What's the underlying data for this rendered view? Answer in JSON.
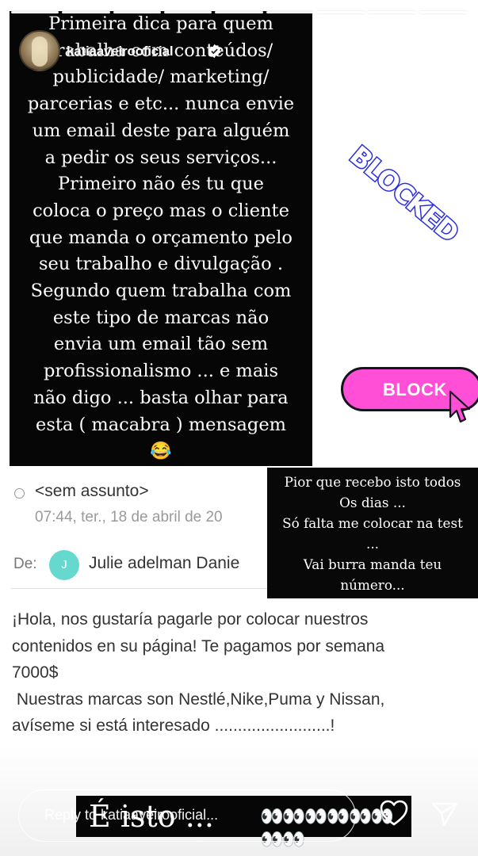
{
  "story": {
    "username": "katiaaveirooficial",
    "progress_segments": 9
  },
  "panel": {
    "lines": [
      "Primeira dica para quem",
      "trabalha com conteúdos/",
      "publicidade/ marketing/",
      "parcerias e etc... nunca envie",
      "um email deste para alguém",
      "a pedir os seus serviços...",
      "Primeiro não és tu que",
      "coloca o preço mas o cliente",
      "que manda o orçamento pelo",
      "seu trabalho e divulgação .",
      "Segundo quem trabalha com",
      "este tipo de marcas não",
      "envia um email tão sem",
      "profissionalismo ... e mais",
      "não digo ... basta olhar para",
      "esta ( macabra ) mensagem"
    ],
    "emoji": "😂"
  },
  "stickers": {
    "blocked": "BLOCKED",
    "block_button": "BLOCK",
    "blocked_color": "#2a2ee0",
    "pill_color": "#ff4fd6"
  },
  "email": {
    "subject": "<sem assunto>",
    "date": "07:44, ter., 18 de abril de 20",
    "from_label": "De:",
    "from_initial": "J",
    "from_name": "Julie adelman Danie",
    "body_lines": [
      "¡Hola, nos gustaría pagarle por colocar nuestros",
      "contenidos en su página! Te pagamos por semana",
      "7000$",
      " Nuestras marcas son Nestlé,Nike,Puma y Nissan,",
      "avíseme si está interesado .........................!"
    ]
  },
  "caption": {
    "lines": [
      "Pior que recebo isto todos",
      "Os dias ...",
      "Só falta me colocar na test",
      "...",
      "Vai burra manda teu",
      "número..."
    ]
  },
  "bottom_text": {
    "text": "É isto ...",
    "emojis": "👀👀👀👀👀👀👀👀"
  },
  "reply": {
    "placeholder": "Reply to katiaaveirooficial..."
  }
}
